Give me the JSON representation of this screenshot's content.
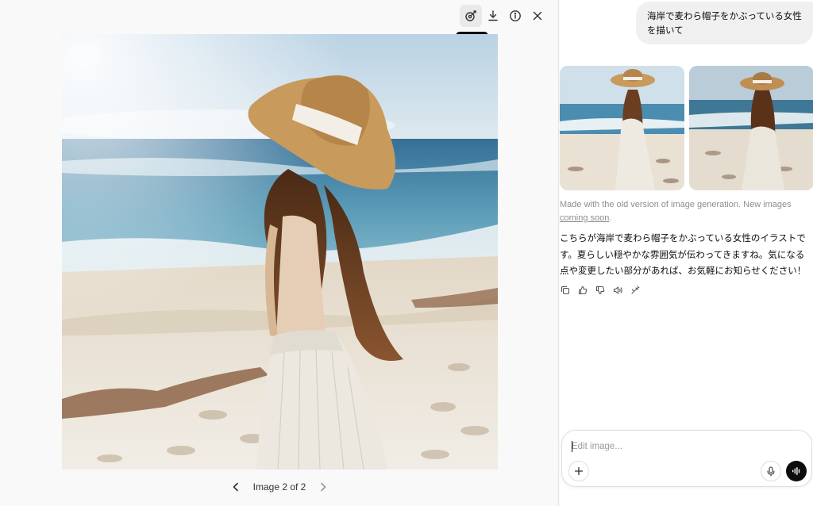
{
  "viewer": {
    "toolbar": {
      "icons": [
        "select-brush-icon",
        "download-icon",
        "info-icon",
        "close-icon"
      ],
      "tooltip": "Select"
    },
    "pager": {
      "label": "Image 2 of 2",
      "current": 2,
      "total": 2
    }
  },
  "chat": {
    "user_message": "海岸で麦わら帽子をかぶっている女性を描いて",
    "note_text": "Made with the old version of image generation. New images ",
    "note_link": "coming soon",
    "note_end": ".",
    "answer": "こちらが海岸で麦わら帽子をかぶっている女性のイラストです。夏らしい穏やかな雰囲気が伝わってきますね。気になる点や変更したい部分があれば、お気軽にお知らせください！",
    "actions": [
      "copy-icon",
      "thumbs-up-icon",
      "thumbs-down-icon",
      "read-aloud-icon",
      "edit-image-icon"
    ],
    "composer": {
      "placeholder": "Edit image..."
    }
  },
  "colors": {
    "sky": "#c9dbe6",
    "sea": "#4f8fb0",
    "sand": "#e6dfd2",
    "hat": "#c89a5c",
    "hair": "#6b3e22",
    "dress": "#ece8df"
  }
}
